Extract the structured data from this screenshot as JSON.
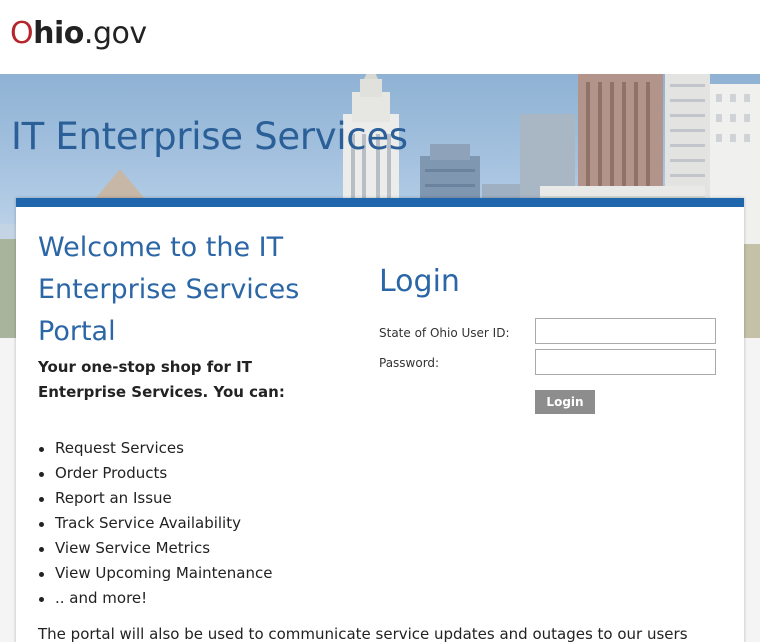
{
  "header": {
    "logo": {
      "o": "O",
      "hio": "hio",
      "dot": ".",
      "gov": "gov"
    }
  },
  "banner": {
    "title": "IT Enterprise Services"
  },
  "welcome": {
    "title": "Welcome to the IT Enterprise Services Portal",
    "tagline": "Your one-stop shop for IT Enterprise Services. You can:",
    "features": [
      "Request Services",
      "Order Products",
      "Report an Issue",
      "Track Service Availability",
      "View Service Metrics",
      "View Upcoming Maintenance",
      ".. and more!"
    ],
    "note": "The portal will also be used to communicate service updates and outages to our users"
  },
  "login": {
    "title": "Login",
    "user_id_label": "State of Ohio User ID:",
    "user_id_value": "",
    "password_label": "Password:",
    "password_value": "",
    "button_label": "Login"
  },
  "colors": {
    "brand_red": "#b5262b",
    "title_blue": "#2b66a6",
    "card_border": "#1f66ad",
    "button_gray": "#8d8d8d"
  }
}
